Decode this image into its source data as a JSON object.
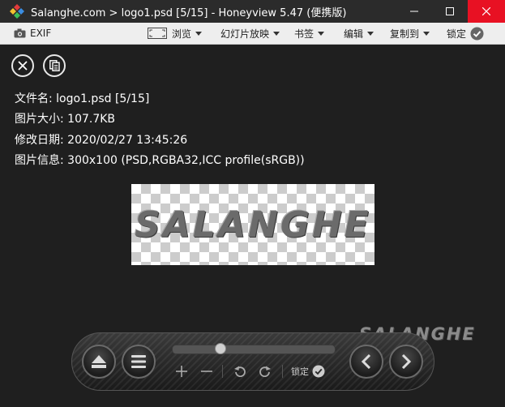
{
  "window": {
    "title": "Salanghe.com > logo1.psd [5/15] - Honeyview 5.47 (便携版)"
  },
  "toolbar": {
    "exif": "EXIF",
    "browse": "浏览",
    "slideshow": "幻灯片放映",
    "bookmark": "书签",
    "edit": "编辑",
    "copy_to": "复制到",
    "lock": "锁定"
  },
  "info": {
    "filename": "文件名: logo1.psd [5/15]",
    "size": "图片大小: 107.7KB",
    "modified": "修改日期: 2020/02/27 13:45:26",
    "details": "图片信息: 300x100 (PSD,RGBA32,ICC profile(sRGB))"
  },
  "image": {
    "logo_text": "SALANGHE"
  },
  "watermark": {
    "text": "SALANGHE"
  },
  "controls": {
    "lock_label": "锁定",
    "slider_position_percent": 28
  },
  "colors": {
    "background": "#1f1f1f",
    "titlebar": "#2b2b2b",
    "close": "#e81123",
    "toolbar": "#eeeeee"
  }
}
